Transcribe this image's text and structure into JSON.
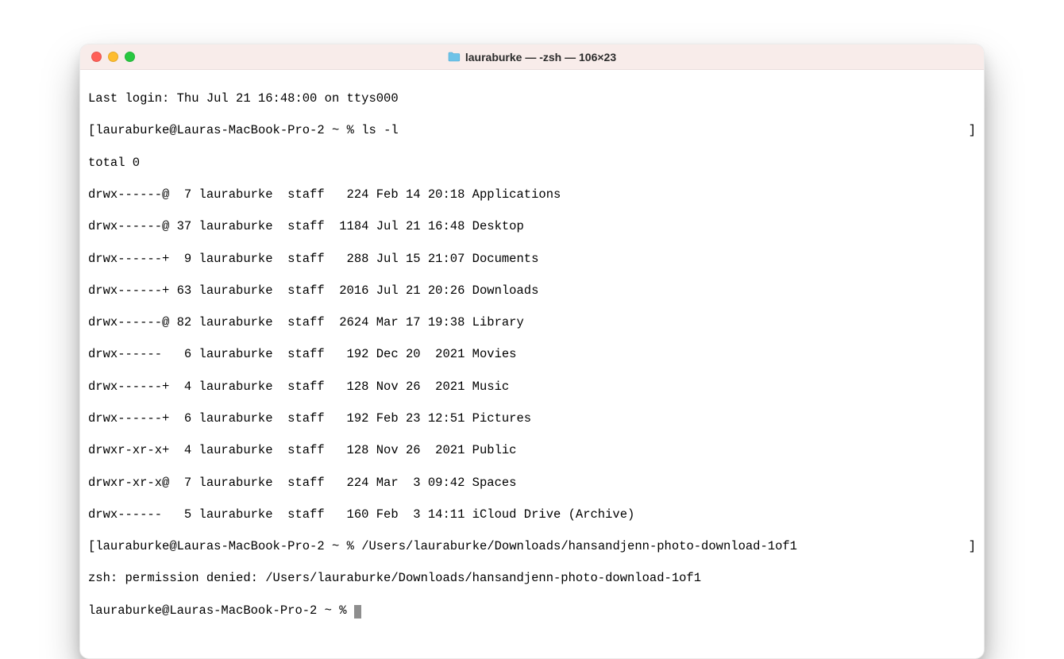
{
  "window": {
    "title": "lauraburke — -zsh — 106×23"
  },
  "session": {
    "last_login": "Last login: Thu Jul 21 16:48:00 on ttys000",
    "prompt_prefix": "lauraburke@Lauras-MacBook-Pro-2 ~ %",
    "first_command": "ls -l",
    "total_line": "total 0",
    "listing": [
      "drwx------@  7 lauraburke  staff   224 Feb 14 20:18 Applications",
      "drwx------@ 37 lauraburke  staff  1184 Jul 21 16:48 Desktop",
      "drwx------+  9 lauraburke  staff   288 Jul 15 21:07 Documents",
      "drwx------+ 63 lauraburke  staff  2016 Jul 21 20:26 Downloads",
      "drwx------@ 82 lauraburke  staff  2624 Mar 17 19:38 Library",
      "drwx------   6 lauraburke  staff   192 Dec 20  2021 Movies",
      "drwx------+  4 lauraburke  staff   128 Nov 26  2021 Music",
      "drwx------+  6 lauraburke  staff   192 Feb 23 12:51 Pictures",
      "drwxr-xr-x+  4 lauraburke  staff   128 Nov 26  2021 Public",
      "drwxr-xr-x@  7 lauraburke  staff   224 Mar  3 09:42 Spaces",
      "drwx------   5 lauraburke  staff   160 Feb  3 14:11 iCloud Drive (Archive)"
    ],
    "second_command": "/Users/lauraburke/Downloads/hansandjenn-photo-download-1of1",
    "error_line": "zsh: permission denied: /Users/lauraburke/Downloads/hansandjenn-photo-download-1of1",
    "bracket_left": "[",
    "bracket_right": "]"
  }
}
